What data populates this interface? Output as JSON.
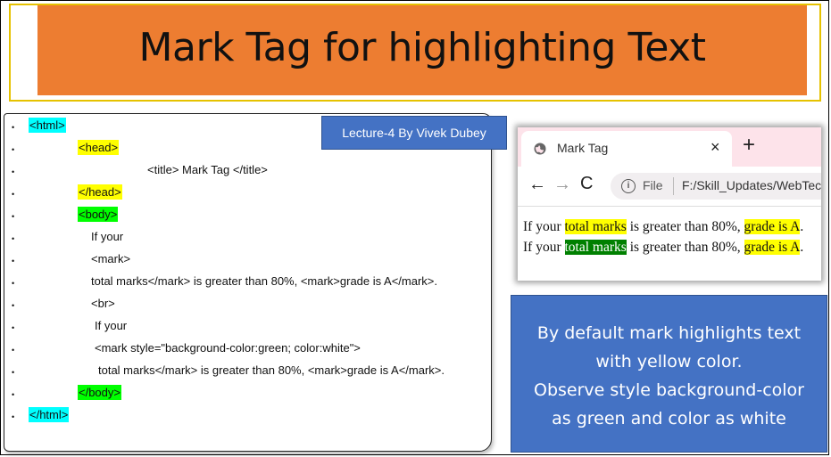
{
  "title": "Mark Tag for highlighting Text",
  "lecture_badge": "Lecture-4 By Vivek Dubey",
  "code_lines": [
    {
      "text": "<html>",
      "highlight": "cyan"
    },
    {
      "text": "<head>",
      "highlight": "yellow"
    },
    {
      "text": "<title> Mark Tag </title>",
      "highlight": ""
    },
    {
      "text": "</head>",
      "highlight": "yellow"
    },
    {
      "text": "<body>",
      "highlight": "green"
    },
    {
      "text": "If your",
      "highlight": ""
    },
    {
      "text": "<mark>",
      "highlight": ""
    },
    {
      "text": "total marks</mark> is greater than 80%, <mark>grade is A</mark>.",
      "highlight": ""
    },
    {
      "text": "<br>",
      "highlight": ""
    },
    {
      "text": "If your",
      "highlight": ""
    },
    {
      "text": "<mark style=\"background-color:green; color:white\">",
      "highlight": ""
    },
    {
      "text": "total marks</mark> is greater than 80%, <mark>grade is A</mark>.",
      "highlight": ""
    },
    {
      "text": "</body>",
      "highlight": "green"
    },
    {
      "text": "</html>",
      "highlight": "cyan"
    }
  ],
  "browser": {
    "tab_title": "Mark Tag",
    "tab_close": "×",
    "new_tab": "+",
    "back": "←",
    "forward": "→",
    "reload": "C",
    "info": "i",
    "file_label": "File",
    "url": "F:/Skill_Updates/WebTechno",
    "line1": {
      "pre": "If your ",
      "mark1": "total marks",
      "mid": " is greater than 80%, ",
      "mark2": "grade is A",
      "post": "."
    },
    "line2": {
      "pre": "If your ",
      "mark1": "total marks",
      "mid": " is greater than 80%, ",
      "mark2": "grade is A",
      "post": "."
    }
  },
  "info_box": {
    "lines": [
      "By default mark highlights text",
      "with yellow color.",
      "Observe style background-color",
      "as green and color as white"
    ]
  },
  "colors": {
    "banner": "#ed7d31",
    "badge": "#4472c4",
    "highlight_cyan": "#00ffff",
    "highlight_yellow": "#ffff00",
    "highlight_green": "#00ff00",
    "mark_green": "#008000"
  }
}
